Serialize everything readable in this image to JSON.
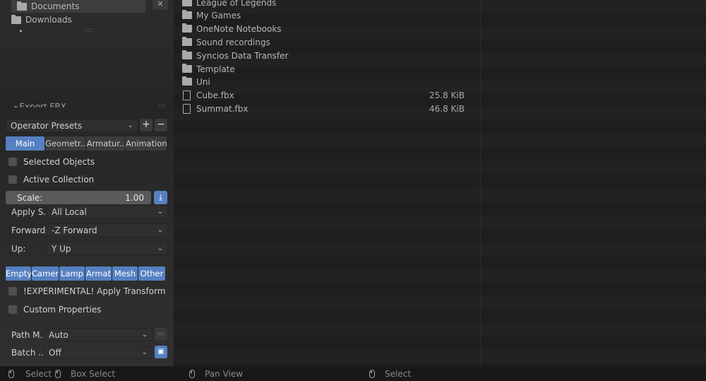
{
  "bookmarks": {
    "items": [
      {
        "label": "Documents",
        "icon": "folder-icon"
      },
      {
        "label": "Downloads",
        "icon": "folder-icon"
      }
    ],
    "close": "✕",
    "expand": "▸",
    "grip": "::::"
  },
  "export_panel": {
    "title": "Export FBX",
    "operator_presets": "Operator Presets",
    "tabs": [
      "Main",
      "Geometr..",
      "Armatur..",
      "Animation"
    ],
    "active_tab": "Main",
    "selected_objects": "Selected Objects",
    "active_collection": "Active Collection",
    "scale_label": "Scale:",
    "scale_value": "1.00",
    "apply_scale_label": "Apply S..",
    "apply_scale_value": "All Local",
    "forward_label": "Forward:",
    "forward_value": "-Z Forward",
    "up_label": "Up:",
    "up_value": "Y Up",
    "object_types": [
      "Empty",
      "Camer",
      "Lamp",
      "Armat",
      "Mesh",
      "Other"
    ],
    "apply_transform": "!EXPERIMENTAL! Apply Transform",
    "custom_properties": "Custom Properties",
    "path_mode_label": "Path M..",
    "path_mode_value": "Auto",
    "batch_label": "Batch ..",
    "batch_value": "Off"
  },
  "files": [
    {
      "name": "League of Legends",
      "type": "folder",
      "size": ""
    },
    {
      "name": "My Games",
      "type": "folder",
      "size": ""
    },
    {
      "name": "OneNote Notebooks",
      "type": "folder",
      "size": ""
    },
    {
      "name": "Sound recordings",
      "type": "folder",
      "size": ""
    },
    {
      "name": "Syncios Data Transfer",
      "type": "folder",
      "size": ""
    },
    {
      "name": "Template",
      "type": "folder",
      "size": ""
    },
    {
      "name": "Uni",
      "type": "folder",
      "size": ""
    },
    {
      "name": "Cube.fbx",
      "type": "file",
      "size": "25.8 KiB"
    },
    {
      "name": "Summat.fbx",
      "type": "file",
      "size": "46.8 KiB"
    }
  ],
  "statusbar": {
    "select": "Select",
    "box_select": "Box Select",
    "pan_view": "Pan View",
    "select_right": "Select"
  },
  "colors": {
    "accent": "#5680c2",
    "background": "#1d1d1d",
    "panel": "#2c2c2c"
  }
}
